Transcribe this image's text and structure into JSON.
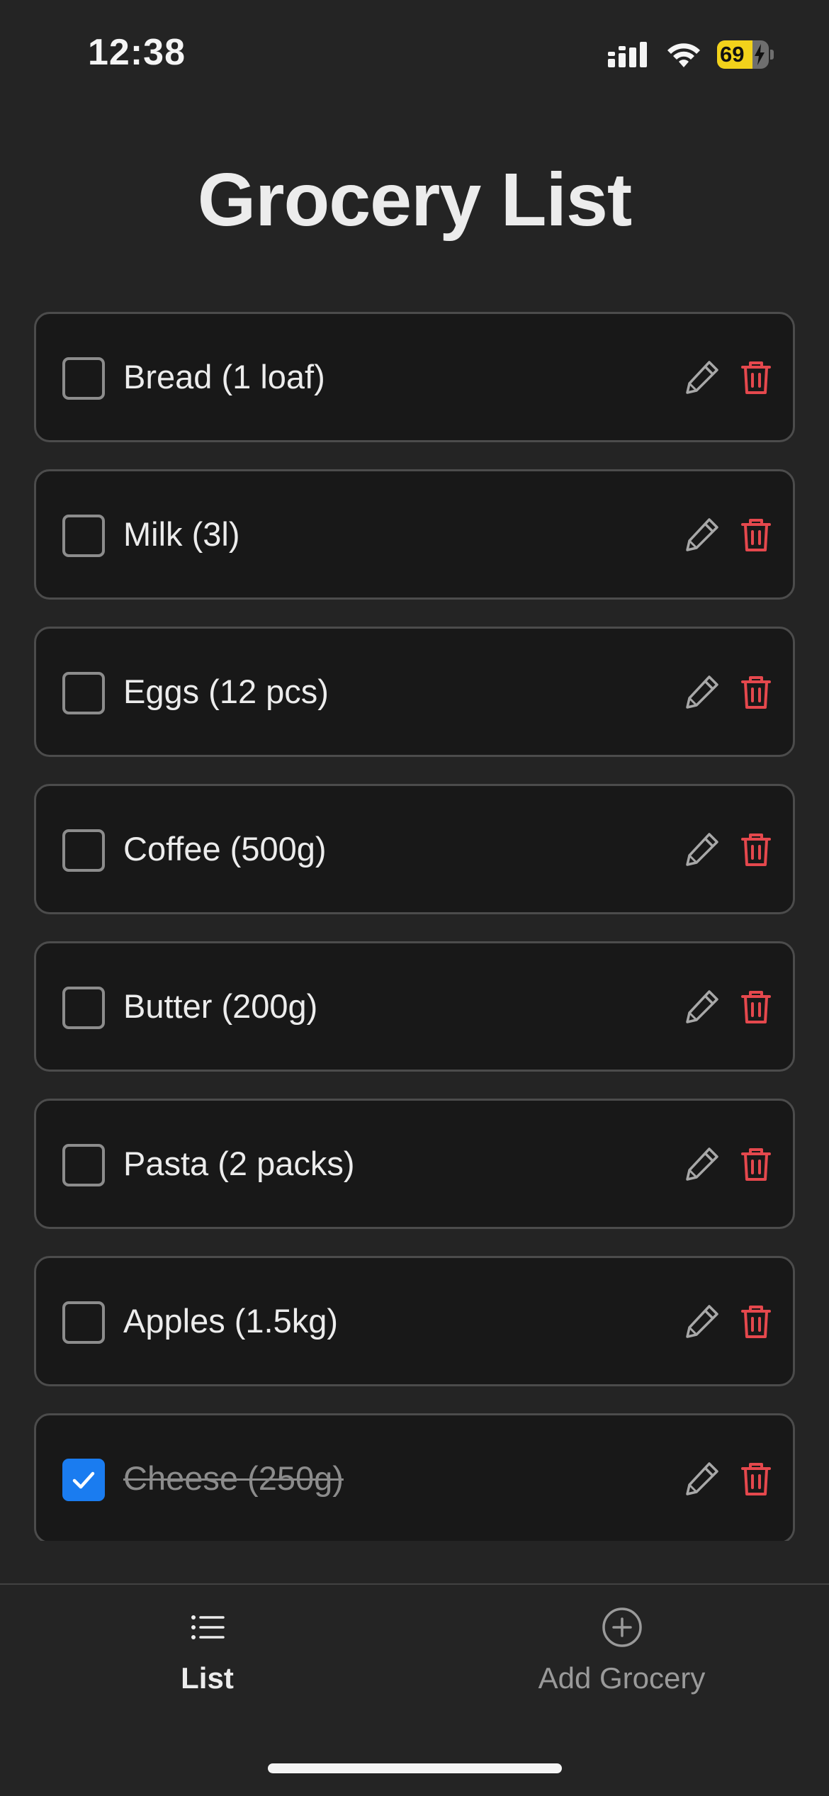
{
  "status_bar": {
    "time": "12:38",
    "battery_level": "69",
    "battery_fraction": 0.69,
    "battery_color": "#f2d21b",
    "battery_charging": true,
    "icons": [
      "cellular-signal-icon",
      "wifi-icon",
      "battery-charging-icon"
    ]
  },
  "page": {
    "title": "Grocery List"
  },
  "items": [
    {
      "label": "Bread (1 loaf)",
      "checked": false
    },
    {
      "label": "Milk (3l)",
      "checked": false
    },
    {
      "label": "Eggs (12 pcs)",
      "checked": false
    },
    {
      "label": "Coffee (500g)",
      "checked": false
    },
    {
      "label": "Butter (200g)",
      "checked": false
    },
    {
      "label": "Pasta (2 packs)",
      "checked": false
    },
    {
      "label": "Apples (1.5kg)",
      "checked": false
    },
    {
      "label": "Cheese (250g)",
      "checked": true
    }
  ],
  "item_actions": {
    "edit_icon": "pencil-icon",
    "delete_icon": "trash-icon",
    "delete_color": "#e5484d",
    "checkbox_checked_color": "#1a7cf0"
  },
  "tab_bar": {
    "tabs": [
      {
        "label": "List",
        "icon": "list-icon",
        "active": true
      },
      {
        "label": "Add Grocery",
        "icon": "plus-circle-icon",
        "active": false
      }
    ]
  }
}
